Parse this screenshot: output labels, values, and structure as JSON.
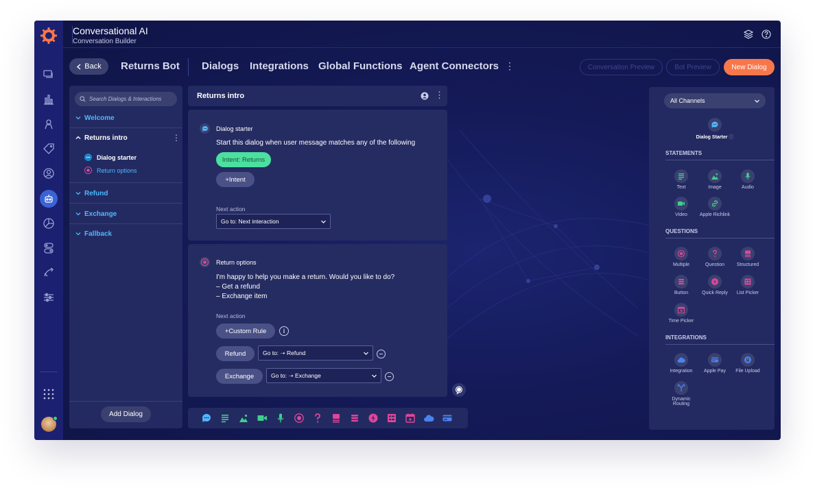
{
  "app": {
    "title": "Conversational AI",
    "subtitle": "Conversation Builder"
  },
  "toolbar": {
    "back_label": "Back",
    "bot_name": "Returns Bot",
    "tabs": [
      "Dialogs",
      "Integrations",
      "Global Functions",
      "Agent Connectors"
    ],
    "conversation_preview": "Conversation Preview",
    "bot_preview": "Bot Preview",
    "new_dialog": "New Dialog"
  },
  "sidebar": {
    "search_placeholder": "Search Dialogs & Interactions",
    "dialogs": [
      {
        "label": "Welcome"
      },
      {
        "label": "Returns intro",
        "children": [
          "Dialog starter",
          "Return options"
        ]
      },
      {
        "label": "Refund"
      },
      {
        "label": "Exchange"
      },
      {
        "label": "Fallback"
      }
    ],
    "add_dialog": "Add Dialog"
  },
  "main": {
    "title": "Returns intro",
    "cards": [
      {
        "type": "Dialog starter",
        "text": "Start this dialog when user message matches any of the following",
        "intent": "Intent: Returns",
        "add_intent": "+Intent",
        "next_action_label": "Next action",
        "next_action": "Go to: Next interaction"
      },
      {
        "type": "Return options",
        "text_line1": "I'm happy to help you make a return. Would you like to do?",
        "text_line2": "– Get a refund",
        "text_line3": "– Exchange item",
        "next_action_label": "Next action",
        "custom_rule": "+Custom Rule",
        "rules": [
          {
            "label": "Refund",
            "target": "Go to: ➝ Refund"
          },
          {
            "label": "Exchange",
            "target": "Go to: ➝ Exchange"
          }
        ]
      }
    ]
  },
  "right_panel": {
    "channel": "All Channels",
    "dialog_starter": "Dialog Starter",
    "sections": {
      "statements": "STATEMENTS",
      "questions": "QUESTIONS",
      "integrations": "INTEGRATIONS"
    },
    "statements": [
      "Text",
      "Image",
      "Audio",
      "Video",
      "Apple Richlink"
    ],
    "questions": [
      "Multiple",
      "Question",
      "Structured",
      "Button",
      "Quick Reply",
      "List Picker",
      "Time Picker"
    ],
    "integrations": [
      "Integration",
      "Apple Pay",
      "File Upload",
      "Dynamic",
      "Routing"
    ]
  },
  "colors": {
    "accent": "#f7774b",
    "intent": "#4be0a0",
    "link": "#4fb8ff",
    "question": "#e0459a",
    "statement": "#3ecf8e",
    "integration": "#4b82f0"
  }
}
